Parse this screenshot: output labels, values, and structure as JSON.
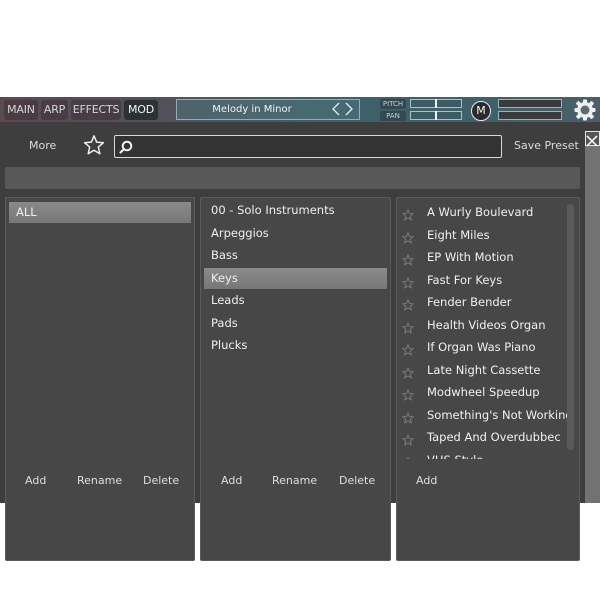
{
  "topbar": {
    "tabs": [
      {
        "label": "MAIN",
        "active": false
      },
      {
        "label": "ARP",
        "active": false
      },
      {
        "label": "EFFECTS",
        "active": false
      },
      {
        "label": "MOD",
        "active": true
      }
    ],
    "preset_name": "Melody in Minor",
    "preset_nav_arrows": "<>",
    "pitch_label": "PITCH",
    "pan_label": "PAN",
    "pitch_value": 0.5,
    "pan_value": 0.5,
    "m_button_label": "M",
    "icons": {
      "gear": "gear-icon",
      "close": "close-icon"
    }
  },
  "search_row": {
    "more_label": "More",
    "favorites_icon": "star-outline-icon",
    "search_placeholder": "",
    "search_value": "",
    "save_preset_label": "Save Preset"
  },
  "banks": {
    "items": [
      {
        "label": "ALL",
        "selected": true
      }
    ],
    "footer": {
      "add": "Add",
      "rename": "Rename",
      "delete": "Delete"
    }
  },
  "categories": {
    "items": [
      {
        "label": "00 - Solo Instruments",
        "selected": false
      },
      {
        "label": "Arpeggios",
        "selected": false
      },
      {
        "label": "Bass",
        "selected": false
      },
      {
        "label": "Keys",
        "selected": true
      },
      {
        "label": "Leads",
        "selected": false
      },
      {
        "label": "Pads",
        "selected": false
      },
      {
        "label": "Plucks",
        "selected": false
      }
    ],
    "footer": {
      "add": "Add",
      "rename": "Rename",
      "delete": "Delete"
    }
  },
  "presets": {
    "items": [
      {
        "label": "A Wurly Boulevard",
        "favorite": false
      },
      {
        "label": "Eight Miles",
        "favorite": false
      },
      {
        "label": "EP With Motion",
        "favorite": false
      },
      {
        "label": "Fast For Keys",
        "favorite": false
      },
      {
        "label": "Fender Bender",
        "favorite": false
      },
      {
        "label": "Health Videos Organ",
        "favorite": false
      },
      {
        "label": "If Organ Was Piano",
        "favorite": false
      },
      {
        "label": "Late Night Cassette",
        "favorite": false
      },
      {
        "label": "Modwheel Speedup",
        "favorite": false
      },
      {
        "label": "Something's Not Working",
        "favorite": false
      },
      {
        "label": "Taped And Overdubbec",
        "favorite": false
      },
      {
        "label": "VHS Style",
        "favorite": false
      }
    ],
    "footer": {
      "add": "Add"
    }
  }
}
